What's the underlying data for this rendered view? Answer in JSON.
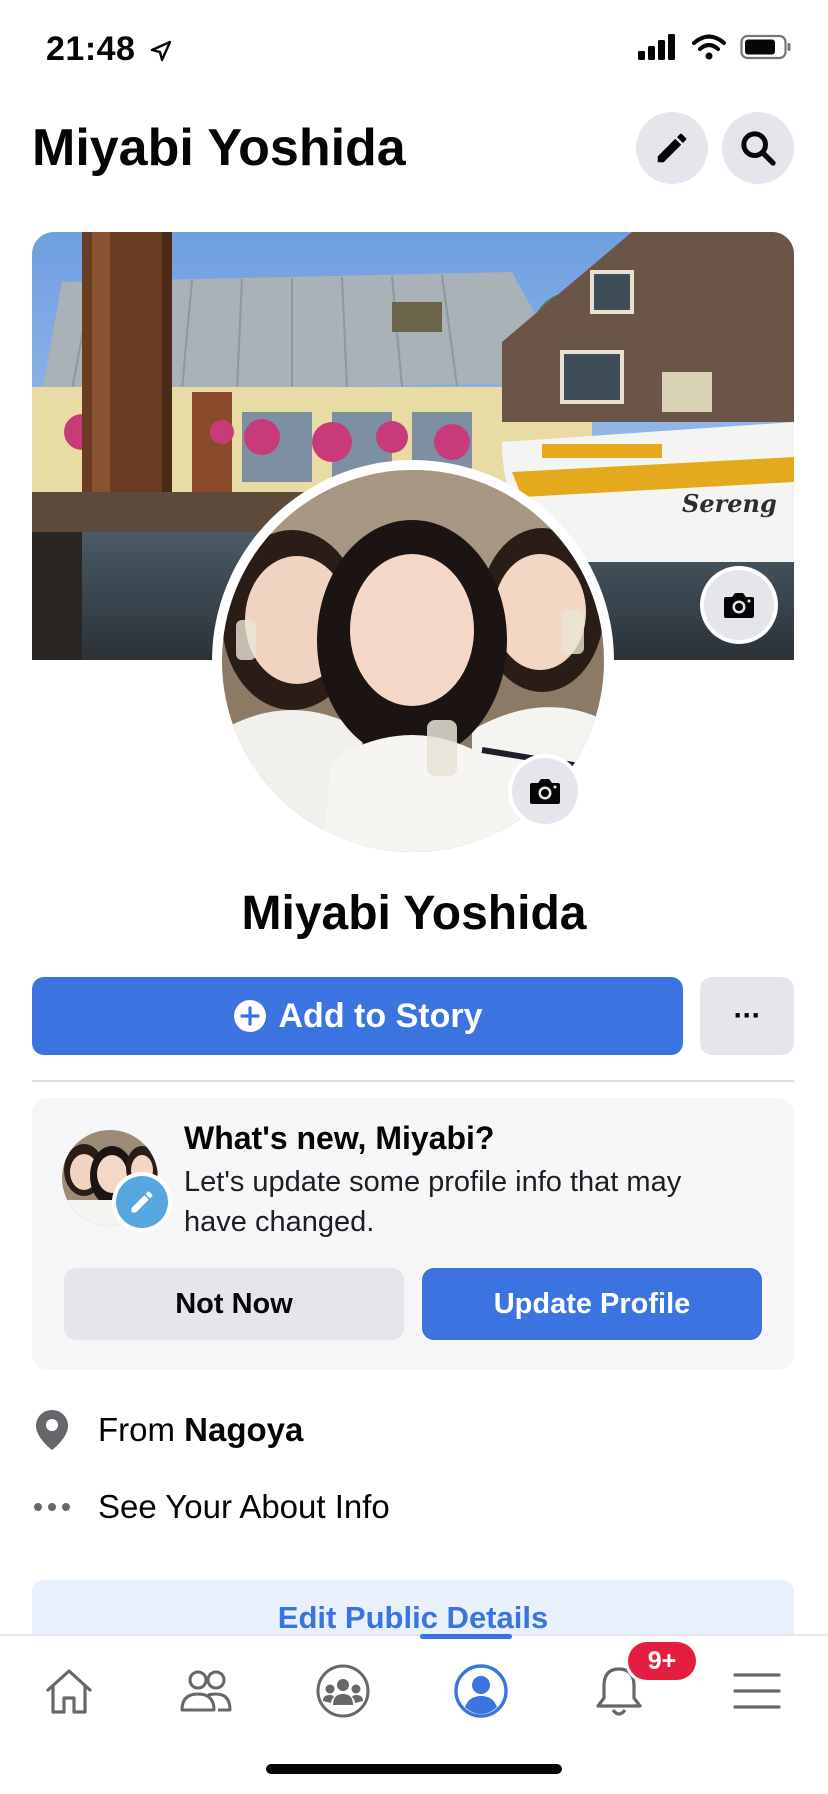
{
  "status_bar": {
    "time": "21:48"
  },
  "header": {
    "title": "Miyabi Yoshida"
  },
  "profile": {
    "name": "Miyabi Yoshida"
  },
  "actions": {
    "add_story_label": "Add to Story",
    "more_label": "···"
  },
  "prompt_card": {
    "title": "What's new, Miyabi?",
    "body": "Let's update some profile info that may have changed.",
    "not_now_label": "Not Now",
    "update_label": "Update Profile"
  },
  "about": {
    "from_prefix": "From",
    "from_place": "Nagoya",
    "see_about_label": "See Your About Info"
  },
  "edit_public_details_label": "Edit Public Details",
  "tabbar": {
    "notification_count": "9+",
    "tabs": [
      "home-icon",
      "friends-icon",
      "groups-icon",
      "profile-icon",
      "notifications-icon",
      "menu-icon"
    ]
  },
  "colors": {
    "accent": "#3b74e0",
    "badge": "#e41e3f",
    "button_gray": "#e4e6eb",
    "card_bg": "#f5f6f8"
  }
}
